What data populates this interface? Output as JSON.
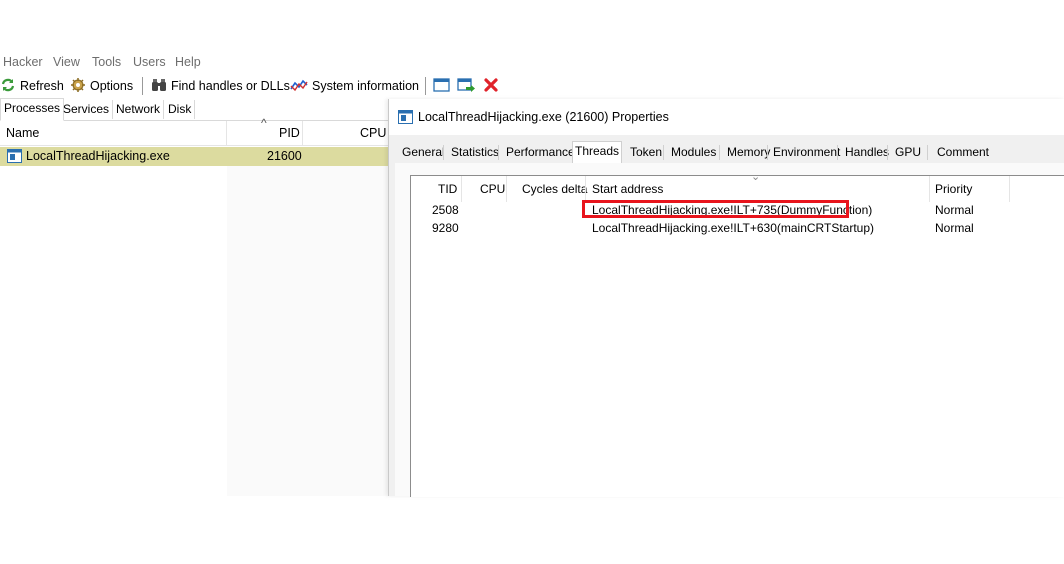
{
  "menu": [
    "Hacker",
    "View",
    "Tools",
    "Users",
    "Help"
  ],
  "toolbar": {
    "refresh": "Refresh",
    "options": "Options",
    "find_handles": "Find handles or DLLs",
    "system_information": "System information"
  },
  "main_tabs": [
    "Processes",
    "Services",
    "Network",
    "Disk"
  ],
  "process_columns": {
    "name": "Name",
    "pid": "PID",
    "cpu": "CPU"
  },
  "process": {
    "name": "LocalThreadHijacking.exe",
    "pid": "21600"
  },
  "properties": {
    "title": "LocalThreadHijacking.exe (21600) Properties",
    "tabs": [
      "General",
      "Statistics",
      "Performance",
      "Threads",
      "Token",
      "Modules",
      "Memory",
      "Environment",
      "Handles",
      "GPU",
      "Comment"
    ],
    "active_tab": "Threads",
    "columns": {
      "tid": "TID",
      "cpu": "CPU",
      "cycles": "Cycles delta",
      "start": "Start address",
      "priority": "Priority"
    },
    "threads": [
      {
        "tid": "2508",
        "start": "LocalThreadHijacking.exe!ILT+735(DummyFunction)",
        "priority": "Normal"
      },
      {
        "tid": "9280",
        "start": "LocalThreadHijacking.exe!ILT+630(mainCRTStartup)",
        "priority": "Normal"
      }
    ]
  },
  "colors": {
    "selected_row": "#dcdb9f",
    "highlight_box": "#e8141c"
  },
  "icons": [
    "refresh-icon",
    "options-gear-icon",
    "find-binoculars-icon",
    "system-info-chart-icon",
    "window-icon",
    "window-go-icon",
    "close-x-icon",
    "application-icon"
  ]
}
